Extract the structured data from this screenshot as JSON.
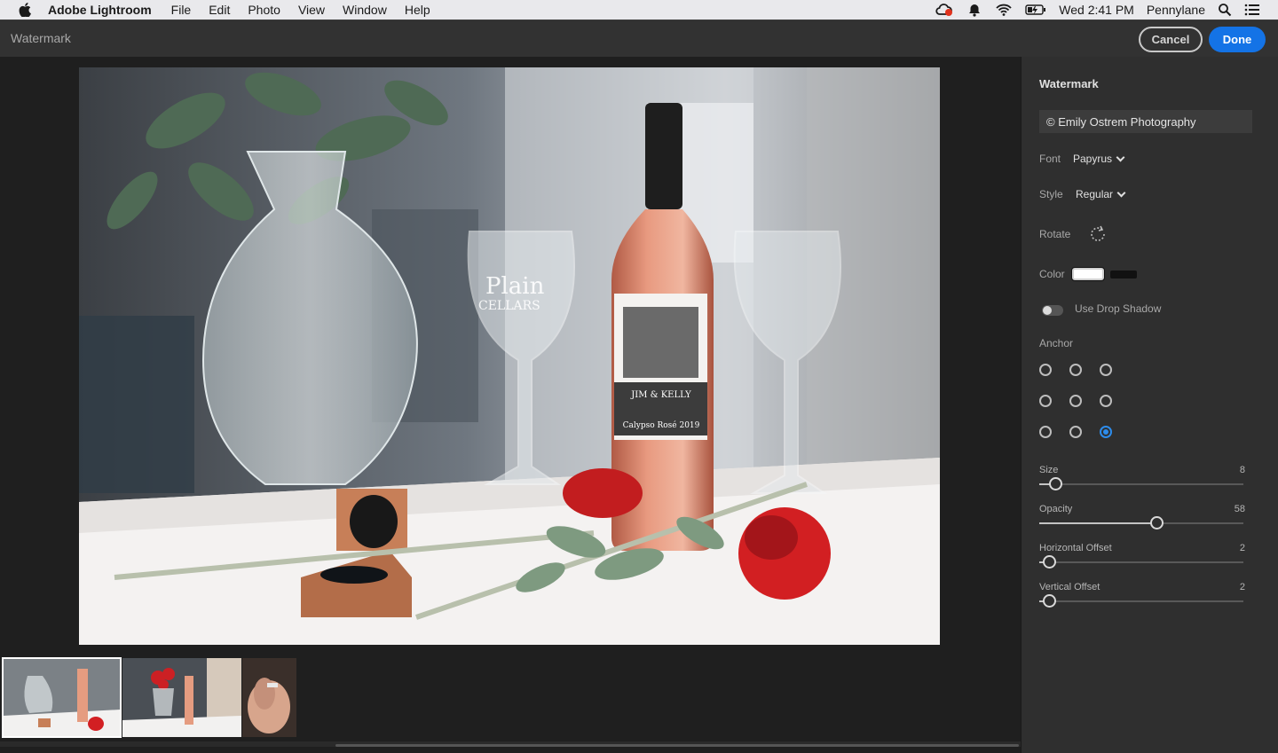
{
  "menubar": {
    "app_name": "Adobe Lightroom",
    "menus": [
      "File",
      "Edit",
      "Photo",
      "View",
      "Window",
      "Help"
    ],
    "clock": "Wed 2:41 PM",
    "user": "Pennylane"
  },
  "titlebar": {
    "title": "Watermark",
    "cancel_label": "Cancel",
    "done_label": "Done"
  },
  "photo": {
    "wine_label_line1": "JIM & KELLY",
    "wine_label_line2": "Calypso Rosé 2019",
    "glass_etching_1": "Plain",
    "glass_etching_2": "CELLARS"
  },
  "panel": {
    "heading": "Watermark",
    "watermark_text": "© Emily Ostrem Photography",
    "font_label": "Font",
    "font_value": "Papyrus",
    "style_label": "Style",
    "style_value": "Regular",
    "rotate_label": "Rotate",
    "color_label": "Color",
    "color_swatches": [
      "#ffffff",
      "#111111"
    ],
    "drop_shadow_label": "Use Drop Shadow",
    "drop_shadow_on": false,
    "anchor_label": "Anchor",
    "anchor_selected": "bottom-right",
    "sliders": [
      {
        "label": "Size",
        "value": "8",
        "fraction": 0.05
      },
      {
        "label": "Opacity",
        "value": "58",
        "fraction": 0.58
      },
      {
        "label": "Horizontal Offset",
        "value": "2",
        "fraction": 0.02
      },
      {
        "label": "Vertical Offset",
        "value": "2",
        "fraction": 0.02
      }
    ]
  },
  "colors": {
    "accent": "#1473e6",
    "panel_bg": "#2f2f2f",
    "canvas_bg": "#1f1f1f"
  }
}
